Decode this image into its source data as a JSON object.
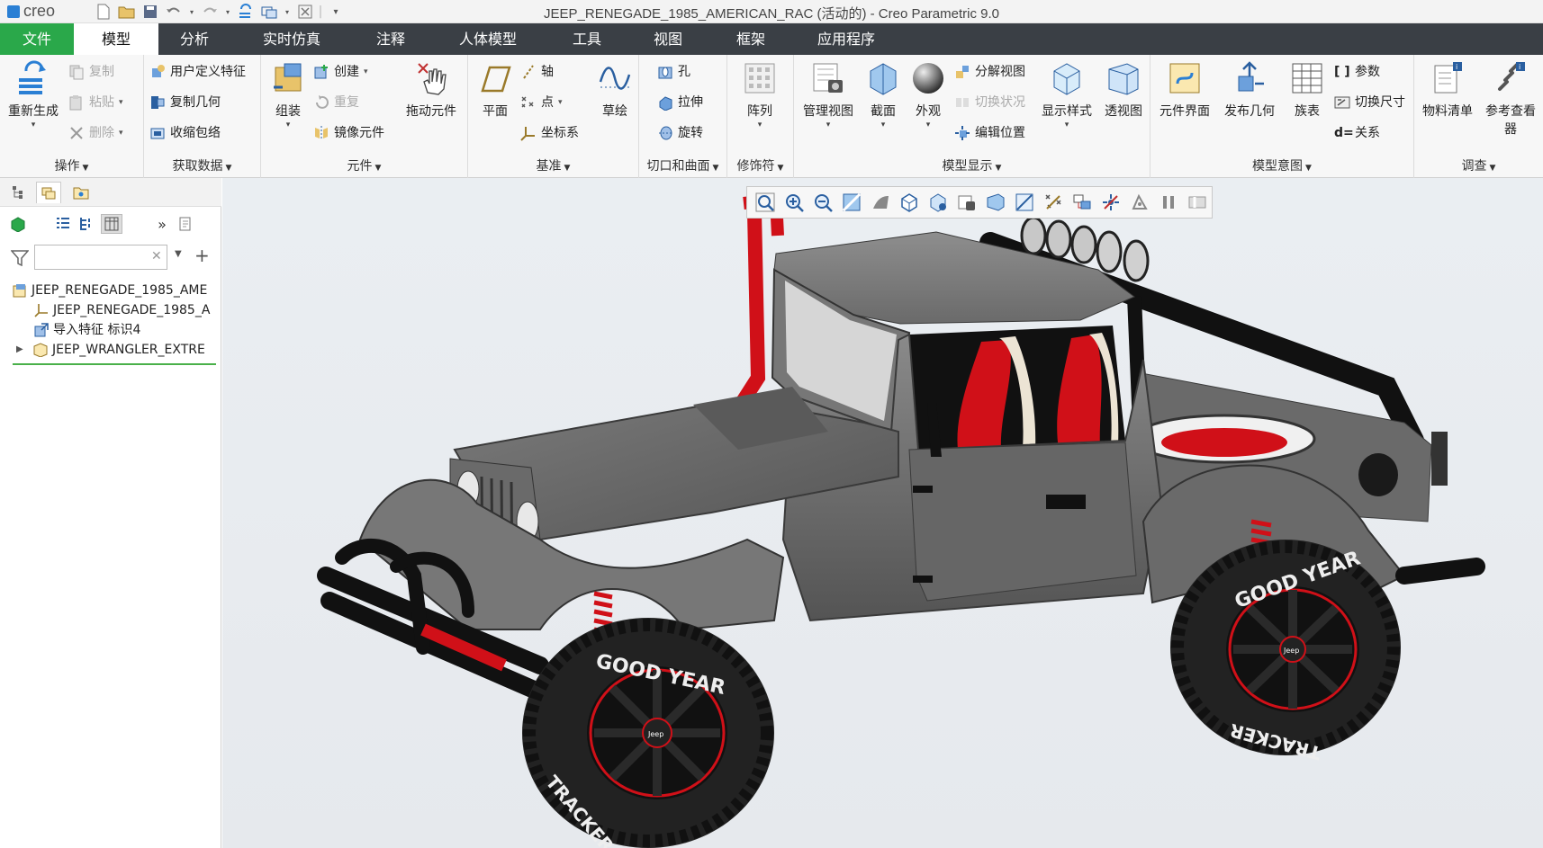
{
  "title_bar": {
    "logo": "creo",
    "window_title": "JEEP_RENEGADE_1985_AMERICAN_RAC (活动的) - Creo Parametric 9.0",
    "quick_access": [
      "new-icon",
      "open-icon",
      "save-icon",
      "undo-icon",
      "redo-icon",
      "regenerate-icon",
      "window-icon",
      "close-window-icon",
      "customize-icon"
    ]
  },
  "tabs": [
    {
      "label": "文件",
      "kind": "file"
    },
    {
      "label": "模型",
      "kind": "active"
    },
    {
      "label": "分析"
    },
    {
      "label": "实时仿真"
    },
    {
      "label": "注释"
    },
    {
      "label": "人体模型"
    },
    {
      "label": "工具"
    },
    {
      "label": "视图"
    },
    {
      "label": "框架"
    },
    {
      "label": "应用程序"
    }
  ],
  "ribbon": {
    "operations": {
      "label": "操作",
      "regenerate": "重新生成",
      "copy": "复制",
      "paste": "粘贴",
      "delete": "删除"
    },
    "get_data": {
      "label": "获取数据",
      "udf": "用户定义特征",
      "copy_geom": "复制几何",
      "shrinkwrap": "收缩包络"
    },
    "component": {
      "label": "元件",
      "assemble": "组装",
      "create": "创建",
      "repeat": "重复",
      "mirror": "镜像元件",
      "drag": "拖动元件"
    },
    "datum": {
      "label": "基准",
      "plane": "平面",
      "axis": "轴",
      "point": "点",
      "csys": "坐标系",
      "sketch": "草绘"
    },
    "cut_surface": {
      "label": "切口和曲面",
      "hole": "孔",
      "extrude": "拉伸",
      "revolve": "旋转"
    },
    "modifiers": {
      "label": "修饰符",
      "pattern": "阵列"
    },
    "model_display": {
      "label": "模型显示",
      "manage_views": "管理视图",
      "section": "截面",
      "appearance": "外观",
      "explode": "分解视图",
      "toggle_status": "切换状况",
      "edit_position": "编辑位置",
      "display_style": "显示样式",
      "perspective": "透视图"
    },
    "model_intent": {
      "label": "模型意图",
      "component_interface": "元件界面",
      "publish_geom": "发布几何",
      "family_table": "族表",
      "parameters": "参数",
      "switch_dims": "切换尺寸",
      "relations": "关系"
    },
    "investigate": {
      "label": "调查",
      "bom": "物料清单",
      "ref_viewer_1": "参考查看",
      "ref_viewer_2": "器"
    }
  },
  "model_tree": {
    "search": {
      "value": "",
      "placeholder": ""
    },
    "items": [
      {
        "label": "JEEP_RENEGADE_1985_AME",
        "icon": "assembly-icon",
        "indent": 0
      },
      {
        "label": "JEEP_RENEGADE_1985_A",
        "icon": "csys-icon",
        "indent": 1
      },
      {
        "label": "导入特征 标识4",
        "icon": "import-feature-icon",
        "indent": 1
      },
      {
        "label": "JEEP_WRANGLER_EXTRE",
        "icon": "part-icon",
        "indent": 1,
        "expandable": true
      }
    ]
  },
  "view_toolbar": [
    "refit-icon",
    "zoom-in-icon",
    "zoom-out-icon",
    "repaint-icon",
    "display-style-icon",
    "standard-orientation-icon",
    "saved-views-icon",
    "view-manager-icon",
    "perspective-icon",
    "datum-display-icon",
    "annotation-display-icon",
    "spin-center-icon",
    "snapshot-icon",
    "appearance-icon",
    "pause-icon",
    "hide-icon"
  ],
  "model": {
    "tire_brand": "GOOD YEAR",
    "tire_model": "TRACKER",
    "hub_badge": "Jeep",
    "colors": {
      "body": "#6e6e6e",
      "accent": "#e0101a",
      "black": "#121212",
      "tire_text": "#f0f0f0"
    }
  },
  "colors": {
    "file_tab": "#2aa84a",
    "tab_bar": "#3a3f45",
    "ribbon_bg": "#f7f7f7",
    "tree_accent": "#49b04a"
  }
}
